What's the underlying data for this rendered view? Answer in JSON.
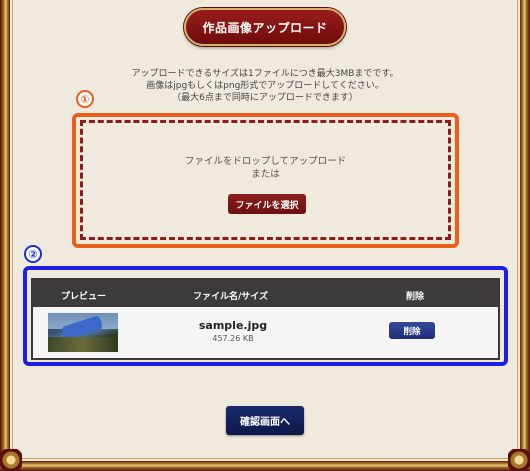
{
  "header": {
    "title": "作品画像アップロード"
  },
  "info": {
    "line1": "アップロードできるサイズは1ファイルにつき最大3MBまでです。",
    "line2": "画像はjpgもしくはpng形式でアップロードしてください。",
    "line3": "（最大6点まで同時にアップロードできます）"
  },
  "markers": {
    "m1": "①",
    "m2": "②"
  },
  "dropzone": {
    "line1": "ファイルをドロップしてアップロード",
    "line2": "または",
    "select_label": "ファイルを選択"
  },
  "table": {
    "headers": {
      "preview": "プレビュー",
      "name": "ファイル名/サイズ",
      "delete": "削除"
    },
    "rows": [
      {
        "filename": "sample.jpg",
        "size": "457.26 KB",
        "delete_label": "削除"
      }
    ]
  },
  "footer": {
    "confirm_label": "確認画面へ"
  },
  "colors": {
    "accent_orange": "#e8601c",
    "accent_blue": "#1e1ee8",
    "brand_red": "#7a1212",
    "navy": "#1a2a6e"
  }
}
